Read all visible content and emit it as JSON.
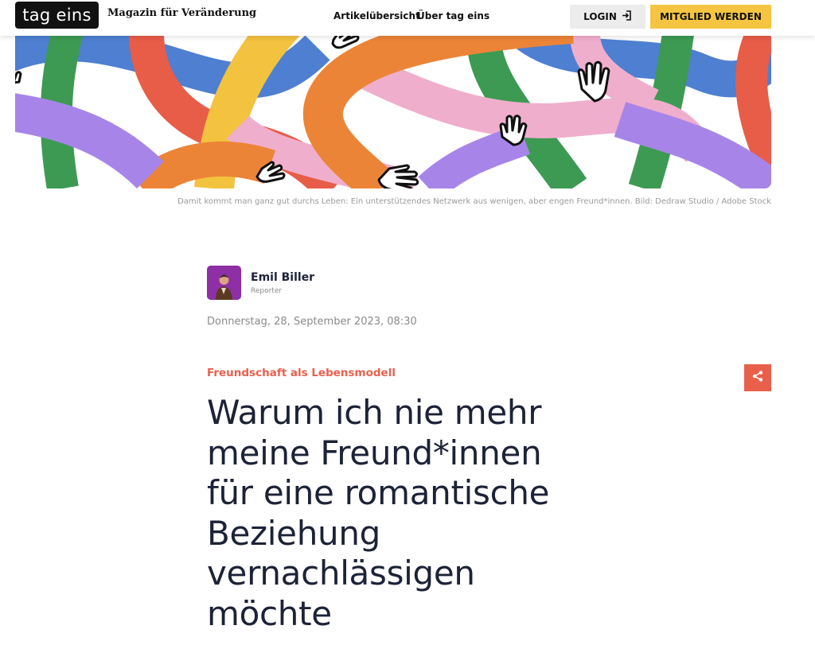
{
  "header": {
    "logo": "tag eins",
    "tagline": "Magazin für Veränderung",
    "nav": [
      "Artikelübersicht",
      "Über tag eins"
    ],
    "login_label": "LOGIN",
    "member_label": "MITGLIED WERDEN",
    "icons": {
      "login": "login-arrow-icon"
    }
  },
  "hero": {
    "caption": "Damit kommt man ganz gut durchs Leben: Ein unterstützendes Netzwerk aus wenigen, aber engen Freund*innen. Bild: Dedraw Studio / Adobe Stock",
    "colors": [
      "#4e7fd1",
      "#3d9a53",
      "#e85d48",
      "#f3c23f",
      "#ec8437",
      "#f0aecd",
      "#a785e8"
    ]
  },
  "article": {
    "author_name": "Emil Biller",
    "author_role": "Reporter",
    "date": "Donnerstag, 28, September 2023, 08:30",
    "kicker": "Freundschaft als Lebensmodell",
    "headline": "Warum ich nie mehr meine Freund*innen für eine romantische Beziehung vernachlässigen möchte",
    "accent_color": "#e8604c",
    "icons": {
      "share": "share-icon"
    }
  }
}
